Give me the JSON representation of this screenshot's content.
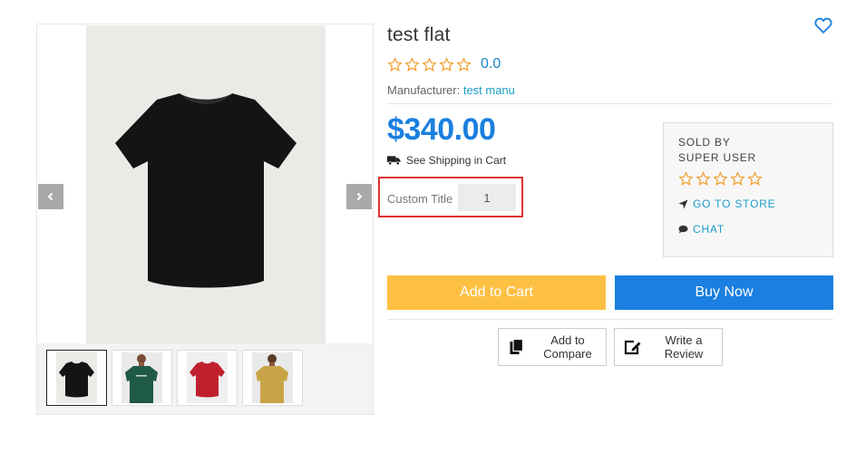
{
  "product": {
    "title": "test flat",
    "rating_value": "0.0",
    "rating_stars": 0,
    "manufacturer_label": "Manufacturer:",
    "manufacturer_name": "test manu",
    "price": "$340.00",
    "shipping_text": "See Shipping in Cart",
    "custom_title_label": "Custom Title",
    "custom_title_value": "1"
  },
  "gallery": {
    "thumbnails": [
      "black t-shirt",
      "green t-shirt model",
      "red t-shirt",
      "yellow t-shirt model"
    ],
    "active_index": 0
  },
  "seller": {
    "sold_by_label": "SOLD BY",
    "name": "SUPER USER",
    "go_to_store": "GO TO STORE",
    "chat": "CHAT"
  },
  "actions": {
    "add_to_cart": "Add to Cart",
    "buy_now": "Buy Now",
    "add_to_compare_line1": "Add to",
    "add_to_compare_line2": "Compare",
    "write_review_line1": "Write a",
    "write_review_line2": "Review"
  },
  "colors": {
    "price_blue": "#1a7fe0",
    "link_blue": "#1a9ec9",
    "star_orange": "#f0a030",
    "cart_yellow": "#fec043",
    "highlight_red": "#e03232"
  },
  "icons": {
    "wishlist": "heart-outline-icon",
    "prev": "chevron-left-icon",
    "next": "chevron-right-icon",
    "shipping": "truck-icon",
    "go_to_store": "location-arrow-icon",
    "chat": "chat-bubble-icon",
    "compare": "copy-icon",
    "review": "edit-icon"
  }
}
